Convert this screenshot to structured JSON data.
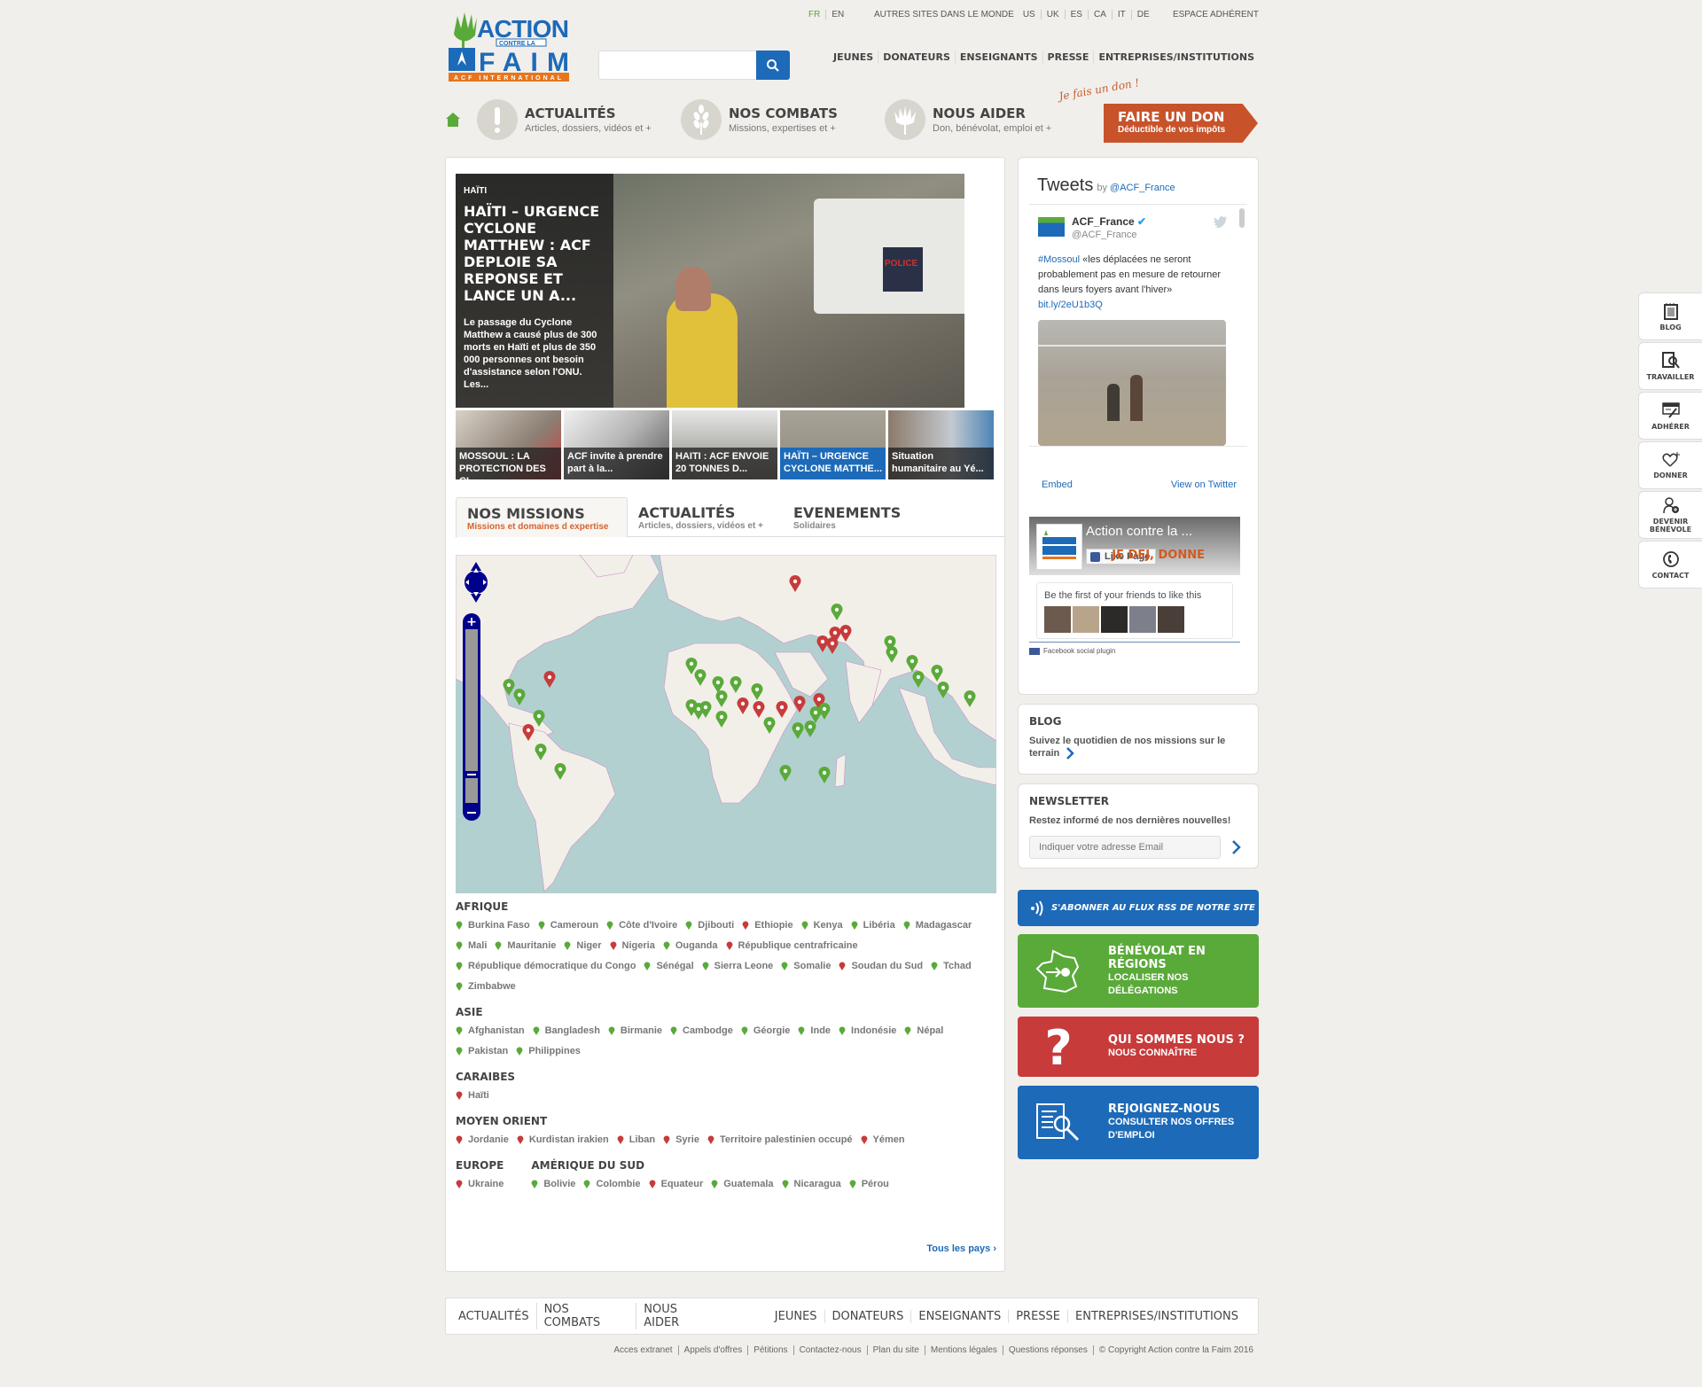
{
  "header": {
    "logo_alt": "Action contre la Faim - ACF International",
    "languages": [
      {
        "label": "FR",
        "active": true
      },
      {
        "label": "EN",
        "active": false
      }
    ],
    "other_sites_label": "AUTRES SITES DANS LE MONDE",
    "other_sites": [
      "US",
      "UK",
      "ES",
      "CA",
      "IT",
      "DE"
    ],
    "member_space": "ESPACE ADHÉRENT",
    "search": {
      "value": "",
      "placeholder": "",
      "icon": "search-icon"
    },
    "audience_nav": [
      "JEUNES",
      "DONATEURS",
      "ENSEIGNANTS",
      "PRESSE",
      "ENTREPRISES/INSTITUTIONS"
    ]
  },
  "main_nav": {
    "home_icon": "home-icon",
    "items": [
      {
        "title": "ACTUALITÉS",
        "subtitle": "Articles, dossiers, vidéos et +",
        "icon": "exclamation-icon"
      },
      {
        "title": "NOS COMBATS",
        "subtitle": "Missions, expertises et +",
        "icon": "wheat-icon"
      },
      {
        "title": "NOUS AIDER",
        "subtitle": "Don, bénévolat, emploi et +",
        "icon": "plant-icon"
      }
    ],
    "donate_note": "Je fais un don !",
    "donate": {
      "title": "FAIRE UN DON",
      "subtitle": "Déductible de vos impôts"
    }
  },
  "hero": {
    "category": "HAÏTI",
    "title": "HAÏTI – URGENCE CYCLONE MATTHEW : ACF DEPLOIE SA REPONSE ET LANCE UN A...",
    "description": "Le passage du Cyclone Matthew a causé plus de 300 morts en Haïti et plus de 350 000 personnes ont besoin d'assistance selon l'ONU. Les...",
    "photo_label": "POLICE"
  },
  "thumbnails": [
    {
      "caption": "MOSSOUL : LA PROTECTION DES CI...",
      "active": false
    },
    {
      "caption": "ACF invite à prendre part à la...",
      "active": false
    },
    {
      "caption": "HAITI : ACF ENVOIE 20 TONNES D...",
      "active": false
    },
    {
      "caption": "HAÏTI – URGENCE CYCLONE MATTHE...",
      "active": true
    },
    {
      "caption": "Situation humanitaire au Yé...",
      "active": false
    }
  ],
  "tabs": [
    {
      "title": "NOS MISSIONS",
      "subtitle": "Missions et domaines d expertise",
      "active": true
    },
    {
      "title": "ACTUALITÉS",
      "subtitle": "Articles, dossiers, vidéos et +",
      "active": false
    },
    {
      "title": "EVENEMENTS",
      "subtitle": "Solidaires",
      "active": false
    }
  ],
  "map": {
    "controls": {
      "pan": "pan-control",
      "zoom_in": "+",
      "zoom_out": "−"
    },
    "colors": {
      "development": "#5aaa3a",
      "emergency": "#c73b3a",
      "sea": "#b3d0d1",
      "land": "#f2efe9",
      "border": "#c98fc9"
    }
  },
  "regions": [
    {
      "name": "AFRIQUE",
      "countries": [
        {
          "name": "Burkina Faso",
          "status": "green"
        },
        {
          "name": "Cameroun",
          "status": "green"
        },
        {
          "name": "Côte d'Ivoire",
          "status": "green"
        },
        {
          "name": "Djibouti",
          "status": "green"
        },
        {
          "name": "Ethiopie",
          "status": "red"
        },
        {
          "name": "Kenya",
          "status": "green"
        },
        {
          "name": "Libéria",
          "status": "green"
        },
        {
          "name": "Madagascar",
          "status": "green"
        },
        {
          "name": "Mali",
          "status": "green"
        },
        {
          "name": "Mauritanie",
          "status": "green"
        },
        {
          "name": "Niger",
          "status": "green"
        },
        {
          "name": "Nigeria",
          "status": "red"
        },
        {
          "name": "Ouganda",
          "status": "green"
        },
        {
          "name": "République centrafricaine",
          "status": "red"
        },
        {
          "name": "République démocratique du Congo",
          "status": "green"
        },
        {
          "name": "Sénégal",
          "status": "green"
        },
        {
          "name": "Sierra Leone",
          "status": "green"
        },
        {
          "name": "Somalie",
          "status": "green"
        },
        {
          "name": "Soudan du Sud",
          "status": "red"
        },
        {
          "name": "Tchad",
          "status": "green"
        },
        {
          "name": "Zimbabwe",
          "status": "green"
        }
      ]
    },
    {
      "name": "ASIE",
      "countries": [
        {
          "name": "Afghanistan",
          "status": "green"
        },
        {
          "name": "Bangladesh",
          "status": "green"
        },
        {
          "name": "Birmanie",
          "status": "green"
        },
        {
          "name": "Cambodge",
          "status": "green"
        },
        {
          "name": "Géorgie",
          "status": "green"
        },
        {
          "name": "Inde",
          "status": "green"
        },
        {
          "name": "Indonésie",
          "status": "green"
        },
        {
          "name": "Népal",
          "status": "green"
        },
        {
          "name": "Pakistan",
          "status": "green"
        },
        {
          "name": "Philippines",
          "status": "green"
        }
      ]
    },
    {
      "name": "CARAIBES",
      "countries": [
        {
          "name": "Haïti",
          "status": "red"
        }
      ]
    },
    {
      "name": "MOYEN ORIENT",
      "countries": [
        {
          "name": "Jordanie",
          "status": "red"
        },
        {
          "name": "Kurdistan irakien",
          "status": "red"
        },
        {
          "name": "Liban",
          "status": "red"
        },
        {
          "name": "Syrie",
          "status": "red"
        },
        {
          "name": "Territoire palestinien occupé",
          "status": "red"
        },
        {
          "name": "Yémen",
          "status": "red"
        }
      ]
    },
    {
      "name": "EUROPE",
      "countries": [
        {
          "name": "Ukraine",
          "status": "red"
        }
      ]
    },
    {
      "name": "AMÉRIQUE DU SUD",
      "countries": [
        {
          "name": "Bolivie",
          "status": "green"
        },
        {
          "name": "Colombie",
          "status": "green"
        },
        {
          "name": "Equateur",
          "status": "red"
        },
        {
          "name": "Guatemala",
          "status": "green"
        },
        {
          "name": "Nicaragua",
          "status": "green"
        },
        {
          "name": "Pérou",
          "status": "green"
        }
      ]
    }
  ],
  "all_countries_link": "Tous les pays",
  "twitter": {
    "title": "Tweets",
    "by": "by",
    "account": "@ACF_France",
    "tweet": {
      "name": "ACF_France",
      "handle": "@ACF_France",
      "hashtag": "#Mossoul",
      "text": " «les déplacées ne seront probablement pas en mesure de retourner dans leurs foyers avant l'hiver» ",
      "link": "bit.ly/2eU1b3Q"
    },
    "embed": "Embed",
    "view_on": "View on Twitter"
  },
  "facebook": {
    "page_name": "Action contre la ...",
    "like_button": "Like Page",
    "cover_text": "JE DEJ, DONNE",
    "friends_text": "Be the first of your friends to like this",
    "plugin_label": "Facebook social plugin"
  },
  "blog": {
    "title": "BLOG",
    "text": "Suivez le quotidien de nos missions sur le terrain"
  },
  "newsletter": {
    "title": "NEWSLETTER",
    "text": "Restez informé de nos dernières nouvelles!",
    "placeholder": "Indiquer votre adresse Email",
    "value": ""
  },
  "cta": {
    "rss": "S'ABONNER AU FLUX RSS DE NOTRE SITE",
    "benevolat": {
      "title": "BÉNÉVOLAT EN RÉGIONS",
      "subtitle": "LOCALISER NOS DÉLÉGATIONS"
    },
    "qui": {
      "title": "QUI SOMMES NOUS ?",
      "subtitle": "NOUS CONNAÎTRE"
    },
    "rejoignez": {
      "title": "REJOIGNEZ-NOUS",
      "subtitle": "CONSULTER NOS OFFRES D'EMPLOI"
    }
  },
  "float_nav": [
    {
      "label": "BLOG",
      "icon": "notepad-icon"
    },
    {
      "label": "TRAVAILLER",
      "icon": "document-search-icon"
    },
    {
      "label": "ADHÉRER",
      "icon": "form-pen-icon"
    },
    {
      "label": "DONNER",
      "icon": "heart-plus-icon"
    },
    {
      "label": "DEVENIR BÉNÉVOLE",
      "icon": "person-add-icon"
    },
    {
      "label": "CONTACT",
      "icon": "phone-icon"
    }
  ],
  "footer": {
    "main_links": [
      "ACTUALITÉS",
      "NOS COMBATS",
      "NOUS AIDER"
    ],
    "audience_links": [
      "JEUNES",
      "DONATEURS",
      "ENSEIGNANTS",
      "PRESSE",
      "ENTREPRISES/INSTITUTIONS"
    ],
    "legal_links": [
      "Acces extranet",
      "Appels d'offres",
      "Pétitions",
      "Contactez-nous",
      "Plan du site",
      "Mentions légales",
      "Questions réponses",
      "© Copyright Action contre la Faim 2016"
    ]
  }
}
